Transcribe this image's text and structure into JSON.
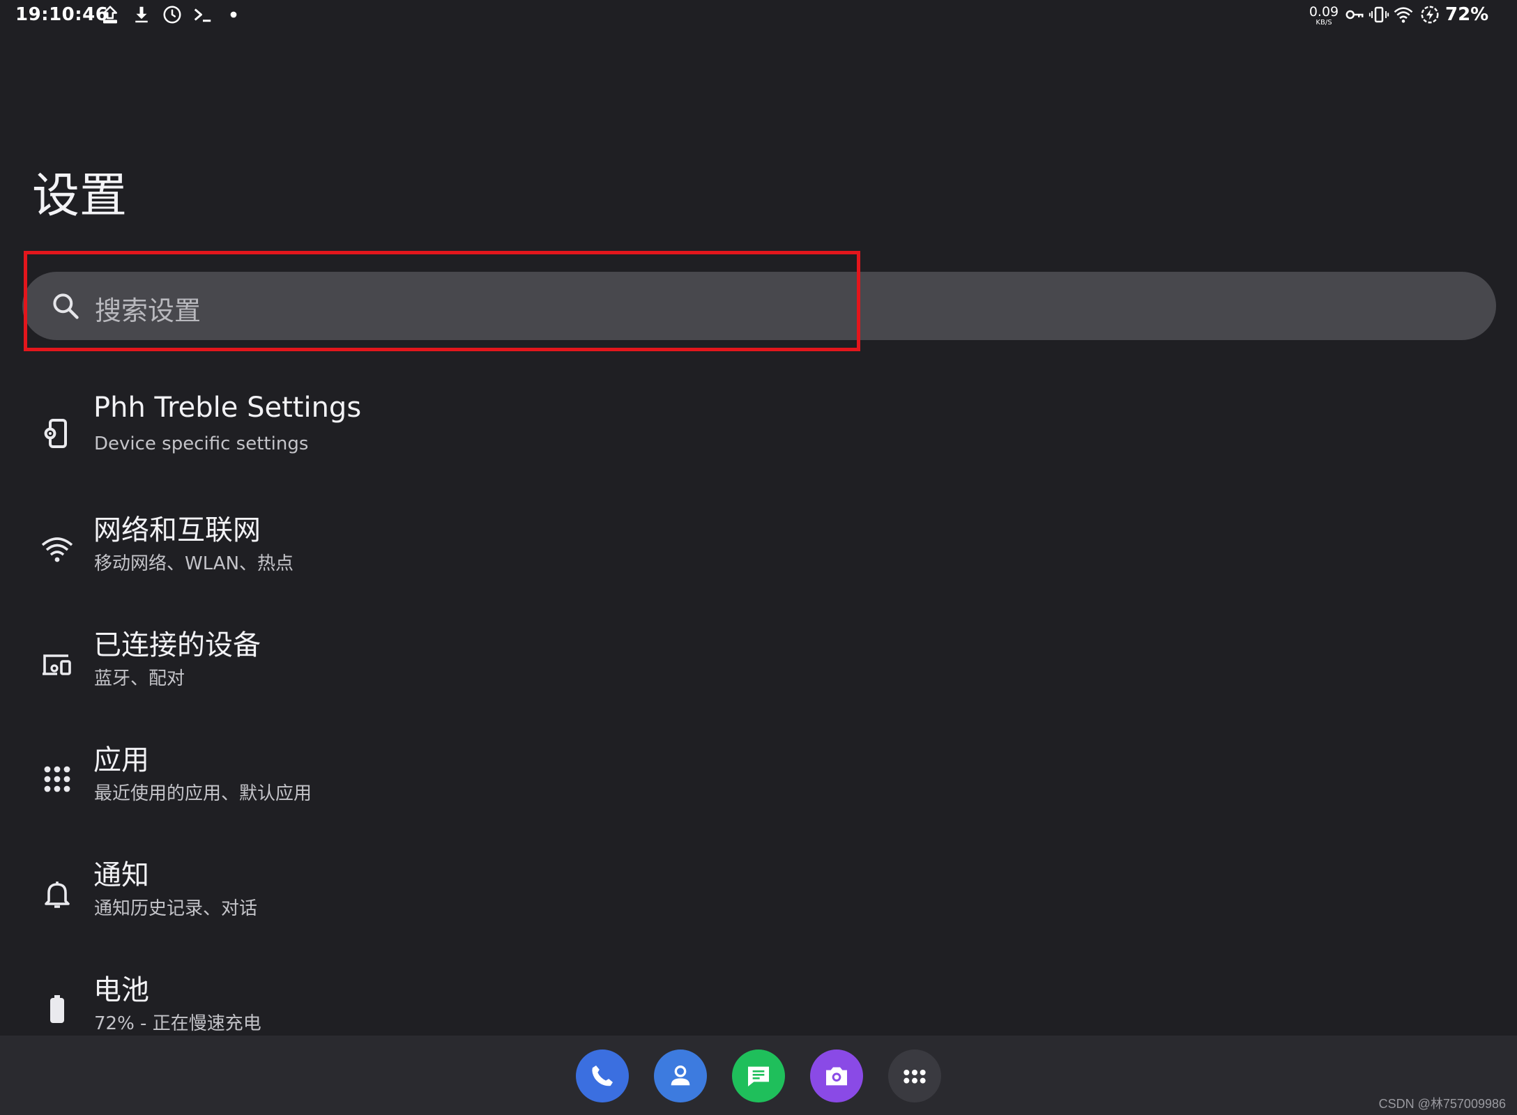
{
  "status_bar": {
    "time": "19:10:46",
    "left_icons": [
      "upload-icon",
      "download-icon",
      "clock-icon",
      "terminal-icon",
      "dot-icon"
    ],
    "net_speed_value": "0.09",
    "net_speed_unit": "KB/S",
    "right_icons": [
      "vpn-key-icon",
      "vibrate-icon",
      "wifi-icon",
      "battery-saver-icon"
    ],
    "battery_percent": "72%"
  },
  "page": {
    "title": "设置"
  },
  "search": {
    "placeholder": "搜索设置"
  },
  "settings_items": [
    {
      "title": "Phh Treble Settings",
      "subtitle": "Device specific settings",
      "icon": "device-settings-icon"
    },
    {
      "title": "网络和互联网",
      "subtitle": "移动网络、WLAN、热点",
      "icon": "wifi-icon"
    },
    {
      "title": "已连接的设备",
      "subtitle": "蓝牙、配对",
      "icon": "connected-devices-icon"
    },
    {
      "title": "应用",
      "subtitle": "最近使用的应用、默认应用",
      "icon": "apps-grid-icon"
    },
    {
      "title": "通知",
      "subtitle": "通知历史记录、对话",
      "icon": "bell-icon"
    },
    {
      "title": "电池",
      "subtitle": "72% - 正在慢速充电",
      "icon": "battery-icon"
    }
  ],
  "dock": {
    "apps": [
      "phone-icon",
      "contacts-icon",
      "messages-icon",
      "camera-icon",
      "app-drawer-icon"
    ]
  },
  "watermark": "CSDN @林757009986",
  "colors": {
    "background": "#1f1f23",
    "search_bg": "#48484d",
    "highlight": "#e3161c",
    "phone": "#3b6fe0",
    "contacts": "#3d7bdf",
    "messages": "#1fbf5b",
    "camera": "#8a4ae6",
    "app_drawer": "#3a3a40"
  }
}
